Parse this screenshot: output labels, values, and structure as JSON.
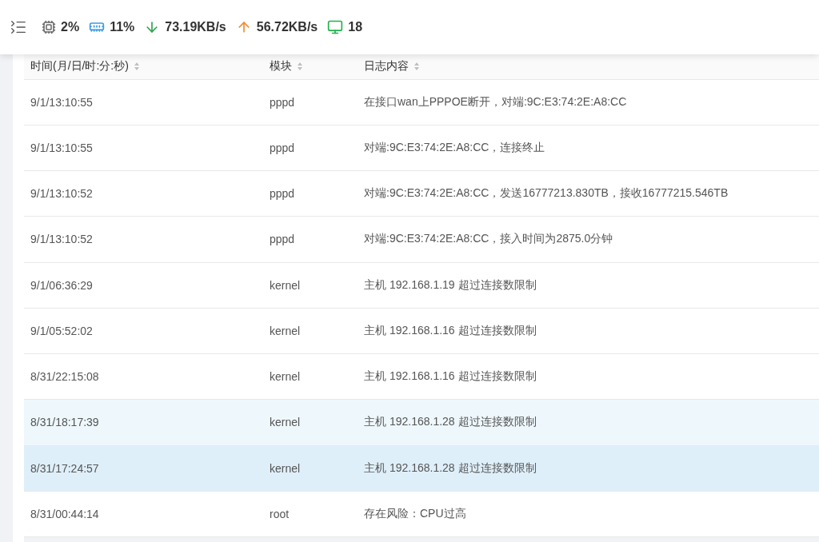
{
  "status_bar": {
    "cpu": "2%",
    "memory": "11%",
    "download": "73.19KB/s",
    "upload": "56.72KB/s",
    "devices": "18"
  },
  "table": {
    "columns": [
      "时间(月/日/时:分:秒)",
      "模块",
      "日志内容"
    ],
    "rows": [
      {
        "time": "9/1/13:10:55",
        "module": "pppd",
        "message": "在接口wan上PPPOE断开，对端:9C:E3:74:2E:A8:CC",
        "hovered": false,
        "selected": false
      },
      {
        "time": "9/1/13:10:55",
        "module": "pppd",
        "message": "对端:9C:E3:74:2E:A8:CC，连接终止",
        "hovered": false,
        "selected": false
      },
      {
        "time": "9/1/13:10:52",
        "module": "pppd",
        "message": "对端:9C:E3:74:2E:A8:CC，发送16777213.830TB，接收16777215.546TB",
        "hovered": false,
        "selected": false
      },
      {
        "time": "9/1/13:10:52",
        "module": "pppd",
        "message": "对端:9C:E3:74:2E:A8:CC，接入时间为2875.0分钟",
        "hovered": false,
        "selected": false
      },
      {
        "time": "9/1/06:36:29",
        "module": "kernel",
        "message": "主机 192.168.1.19 超过连接数限制",
        "hovered": false,
        "selected": false
      },
      {
        "time": "9/1/05:52:02",
        "module": "kernel",
        "message": "主机 192.168.1.16 超过连接数限制",
        "hovered": false,
        "selected": false
      },
      {
        "time": "8/31/22:15:08",
        "module": "kernel",
        "message": "主机 192.168.1.16 超过连接数限制",
        "hovered": false,
        "selected": false
      },
      {
        "time": "8/31/18:17:39",
        "module": "kernel",
        "message": "主机 192.168.1.28 超过连接数限制",
        "hovered": true,
        "selected": false
      },
      {
        "time": "8/31/17:24:57",
        "module": "kernel",
        "message": "主机 192.168.1.28 超过连接数限制",
        "hovered": false,
        "selected": true
      },
      {
        "time": "8/31/00:44:14",
        "module": "root",
        "message": "存在风险：CPU过高",
        "hovered": false,
        "selected": false
      }
    ]
  }
}
